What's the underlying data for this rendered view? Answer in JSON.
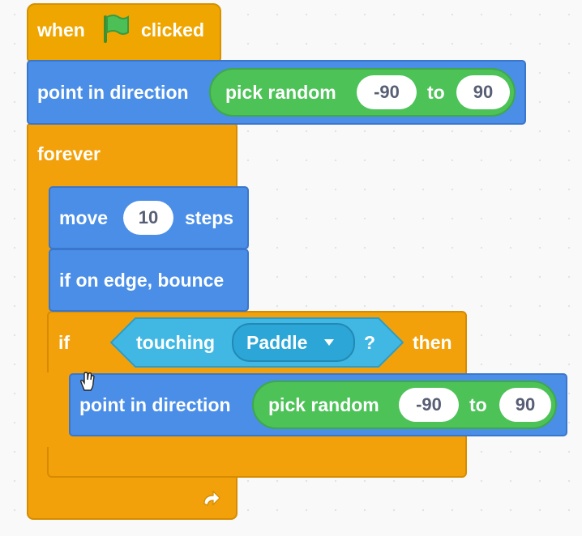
{
  "hat": {
    "when": "when",
    "clicked": "clicked",
    "flag_icon": "green-flag"
  },
  "point1": {
    "label": "point in direction",
    "op_label": "pick random",
    "from": "-90",
    "to_label": "to",
    "to": "90"
  },
  "forever": {
    "label": "forever",
    "loop_icon": "loop-arrow"
  },
  "move": {
    "label": "move",
    "value": "10",
    "suffix": "steps"
  },
  "bounce": {
    "label": "if on edge, bounce"
  },
  "if_block": {
    "if_label": "if",
    "touching_label": "touching",
    "target": "Paddle",
    "question": "?",
    "then_label": "then"
  },
  "point2": {
    "label": "point in direction",
    "op_label": "pick random",
    "from": "-90",
    "to_label": "to",
    "to": "90"
  },
  "colors": {
    "events": "#f0a600",
    "motion": "#4a8ee8",
    "control": "#f2a10a",
    "operators": "#4cc257",
    "sensing": "#41b8e3"
  }
}
